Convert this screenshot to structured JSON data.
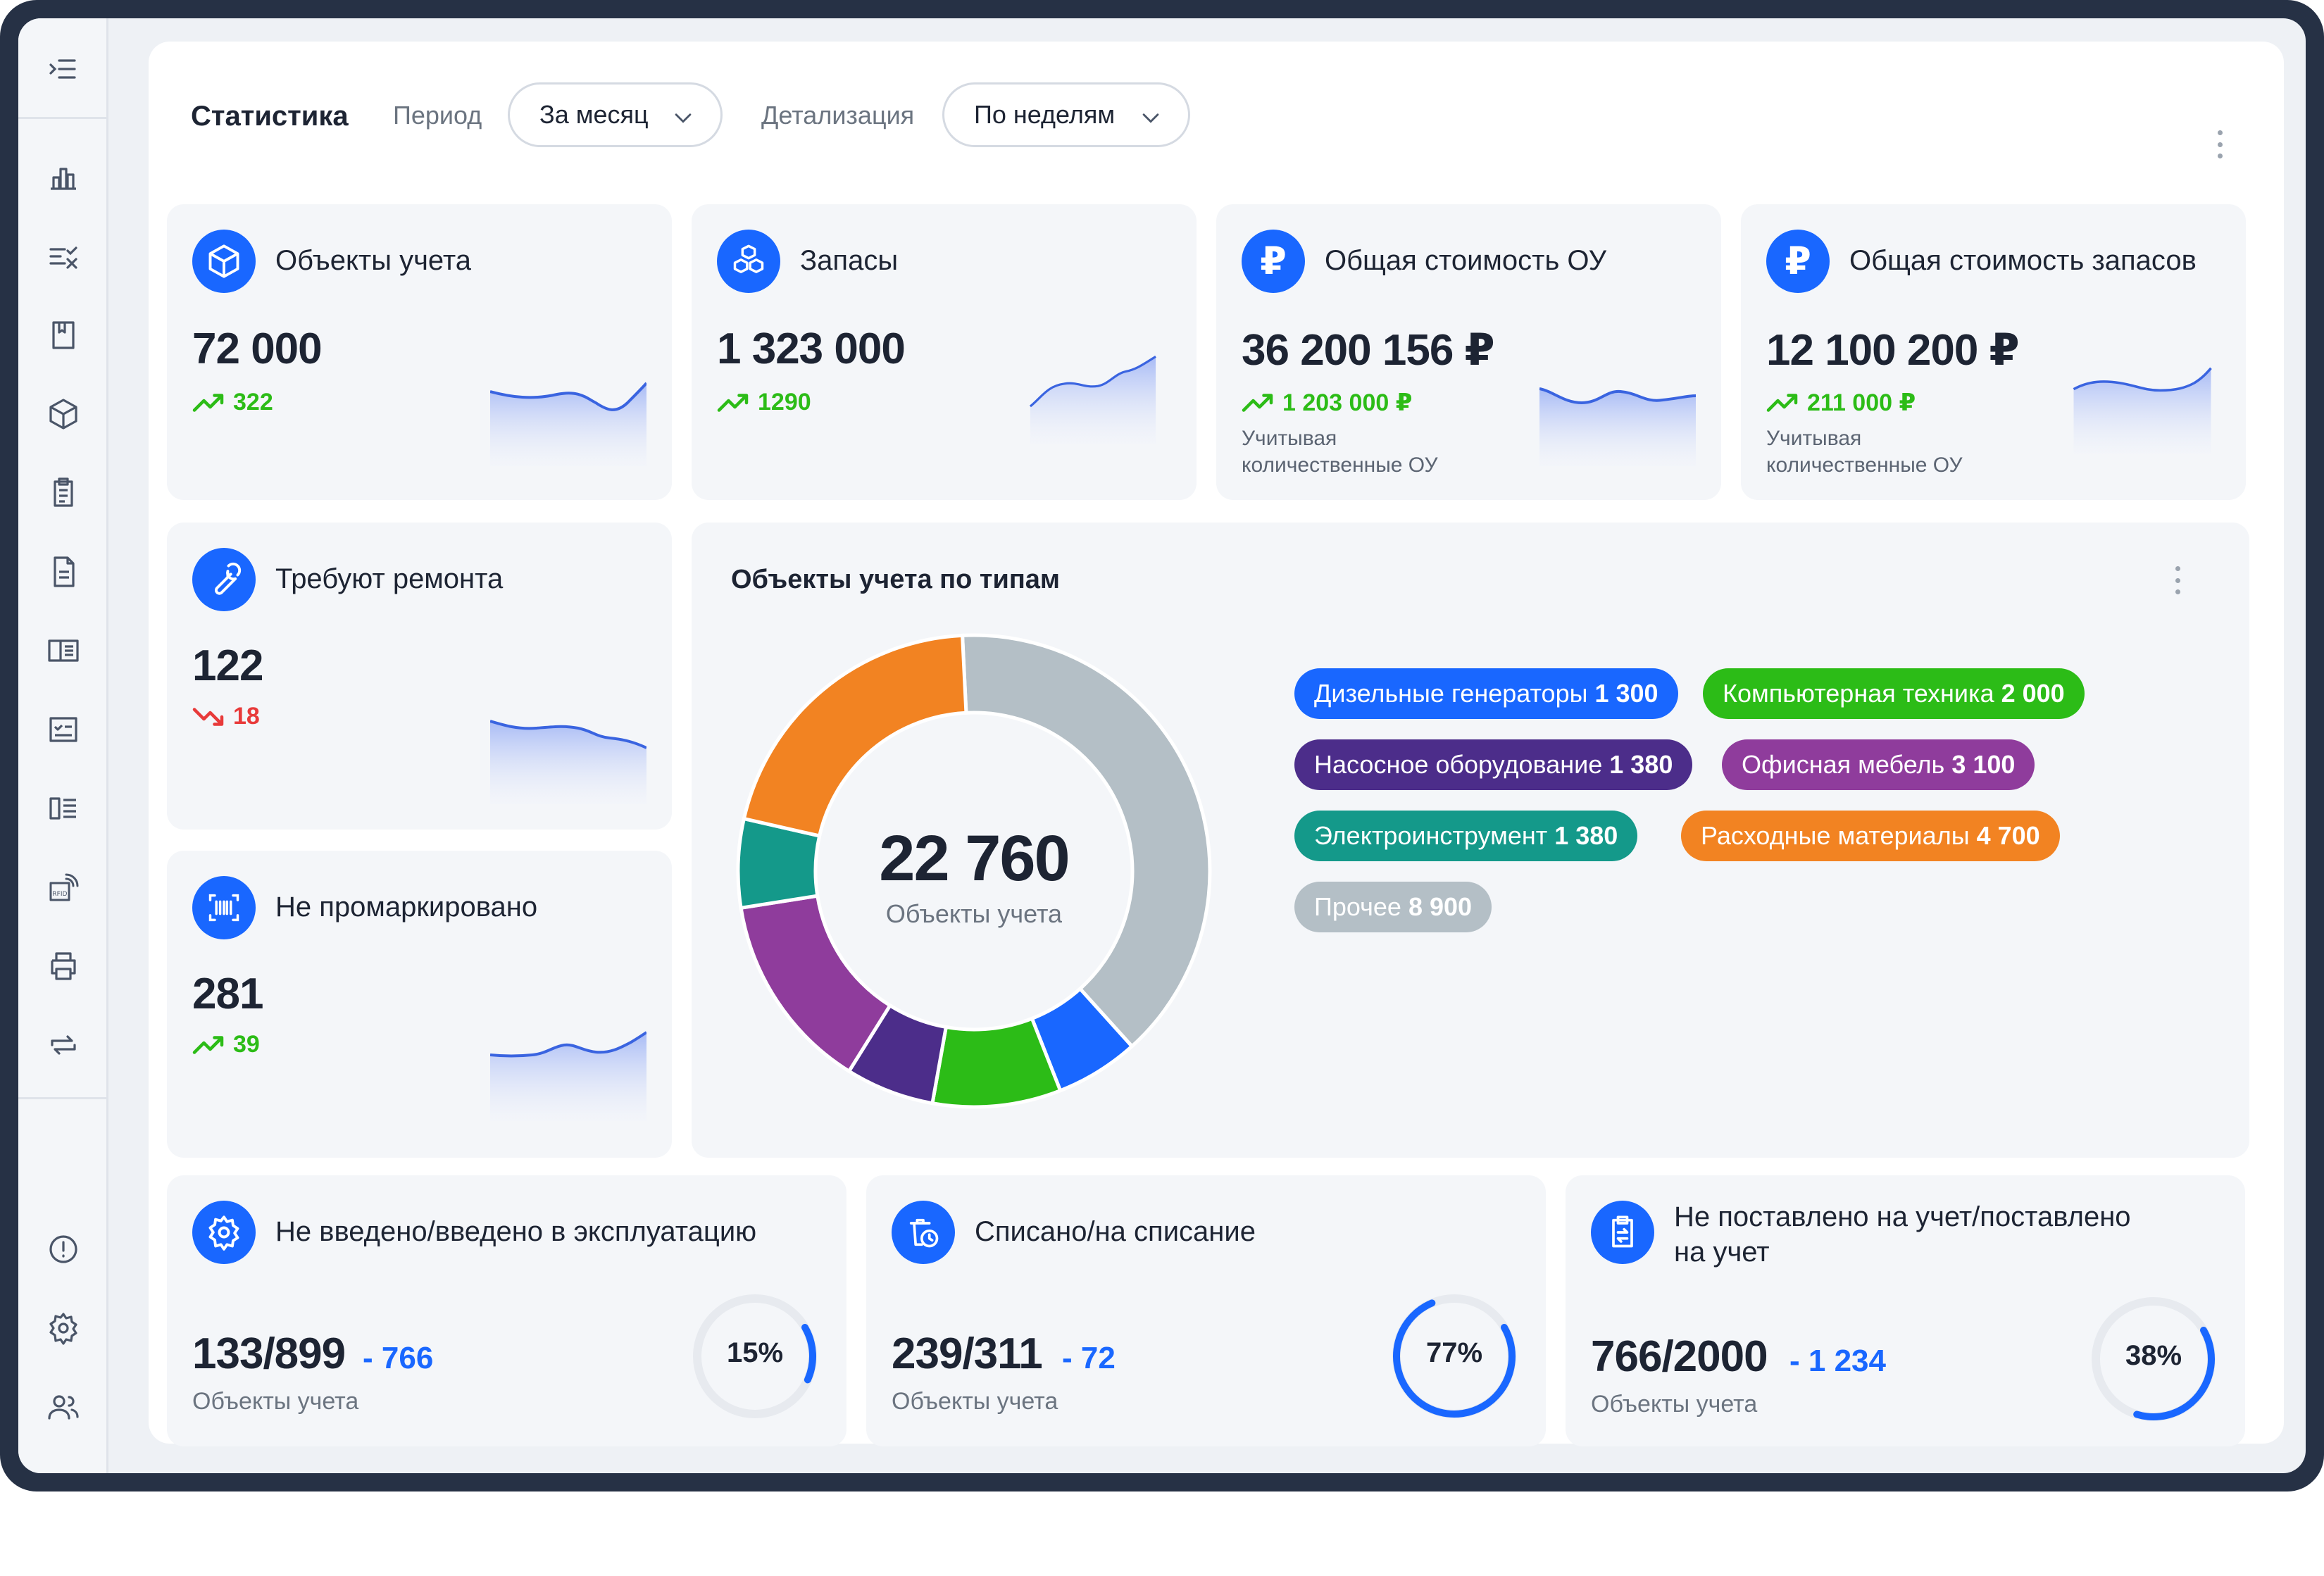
{
  "header": {
    "title": "Статистика",
    "period_label": "Период",
    "period_value": "За месяц",
    "detail_label": "Детализация",
    "detail_value": "По неделям"
  },
  "kpi": [
    {
      "title": "Объекты учета",
      "value": "72 000",
      "delta": "322",
      "trend": "up",
      "icon": "cube-icon"
    },
    {
      "title": "Запасы",
      "value": "1 323 000",
      "delta": "1290",
      "trend": "up",
      "icon": "boxes-icon"
    },
    {
      "title": "Общая стоимость ОУ",
      "value": "36 200 156 ₽",
      "delta": "1 203 000 ₽",
      "trend": "up",
      "note1": "Учитывая",
      "note2": "количественные ОУ",
      "icon": "ruble-icon"
    },
    {
      "title": "Общая стоимость запасов",
      "value": "12 100 200 ₽",
      "delta": "211 000 ₽",
      "trend": "up",
      "note1": "Учитывая",
      "note2": "количественные ОУ",
      "icon": "ruble-icon"
    }
  ],
  "repair": {
    "title": "Требуют ремонта",
    "value": "122",
    "delta": "18",
    "trend": "down"
  },
  "unmarked": {
    "title": "Не промаркировано",
    "value": "281",
    "delta": "39",
    "trend": "up"
  },
  "types_chart": {
    "title": "Объекты учета по типам",
    "center_value": "22 760",
    "center_label": "Объекты учета"
  },
  "chart_data": {
    "type": "pie",
    "title": "Объекты учета по типам",
    "total": 22760,
    "slices": [
      {
        "name": "Дизельные генераторы",
        "label": "1 300",
        "value": 1300,
        "color": "#1967ff"
      },
      {
        "name": "Компьютерная техника",
        "label": "2 000",
        "value": 2000,
        "color": "#2cbc17"
      },
      {
        "name": "Насосное оборудование",
        "label": "1 380",
        "value": 1380,
        "color": "#4c2d8a"
      },
      {
        "name": "Офисная мебель",
        "label": "3 100",
        "value": 3100,
        "color": "#8f3c9c"
      },
      {
        "name": "Электроинструмент",
        "label": "1 380",
        "value": 1380,
        "color": "#14998a"
      },
      {
        "name": "Расходные материалы",
        "label": "4 700",
        "value": 4700,
        "color": "#f28322"
      },
      {
        "name": "Прочее",
        "label": "8 900",
        "value": 8900,
        "color": "#b4bfc6"
      }
    ]
  },
  "bottom": [
    {
      "title": "Не введено/введено в эксплуатацию",
      "value": "133/899",
      "delta": "- 766",
      "sub": "Объекты учета",
      "pct_label": "15%",
      "pct": 15
    },
    {
      "title": "Списано/на списание",
      "value": "239/311",
      "delta": "- 72",
      "sub": "Объекты учета",
      "pct_label": "77%",
      "pct": 77
    },
    {
      "title_line1": "Не поставлено на учет/поставлено",
      "title_line2": "на учет",
      "value": "766/2000",
      "delta": "- 1 234",
      "sub": "Объекты учета",
      "pct_label": "38%",
      "pct": 38
    }
  ],
  "sidebar": {
    "icons": [
      "collapse-menu-icon",
      "bar-chart-icon",
      "checklist-icon",
      "book-icon",
      "cube-icon",
      "clipboard-icon",
      "document-icon",
      "catalog-icon",
      "task-list-icon",
      "list-icon",
      "rfid-icon",
      "printer-icon",
      "sync-icon",
      "info-icon",
      "settings-icon",
      "users-icon"
    ]
  },
  "colors": {
    "accent": "#1967ff",
    "positive": "#2cbc17",
    "negative": "#e83a3a",
    "frame": "#263145"
  }
}
